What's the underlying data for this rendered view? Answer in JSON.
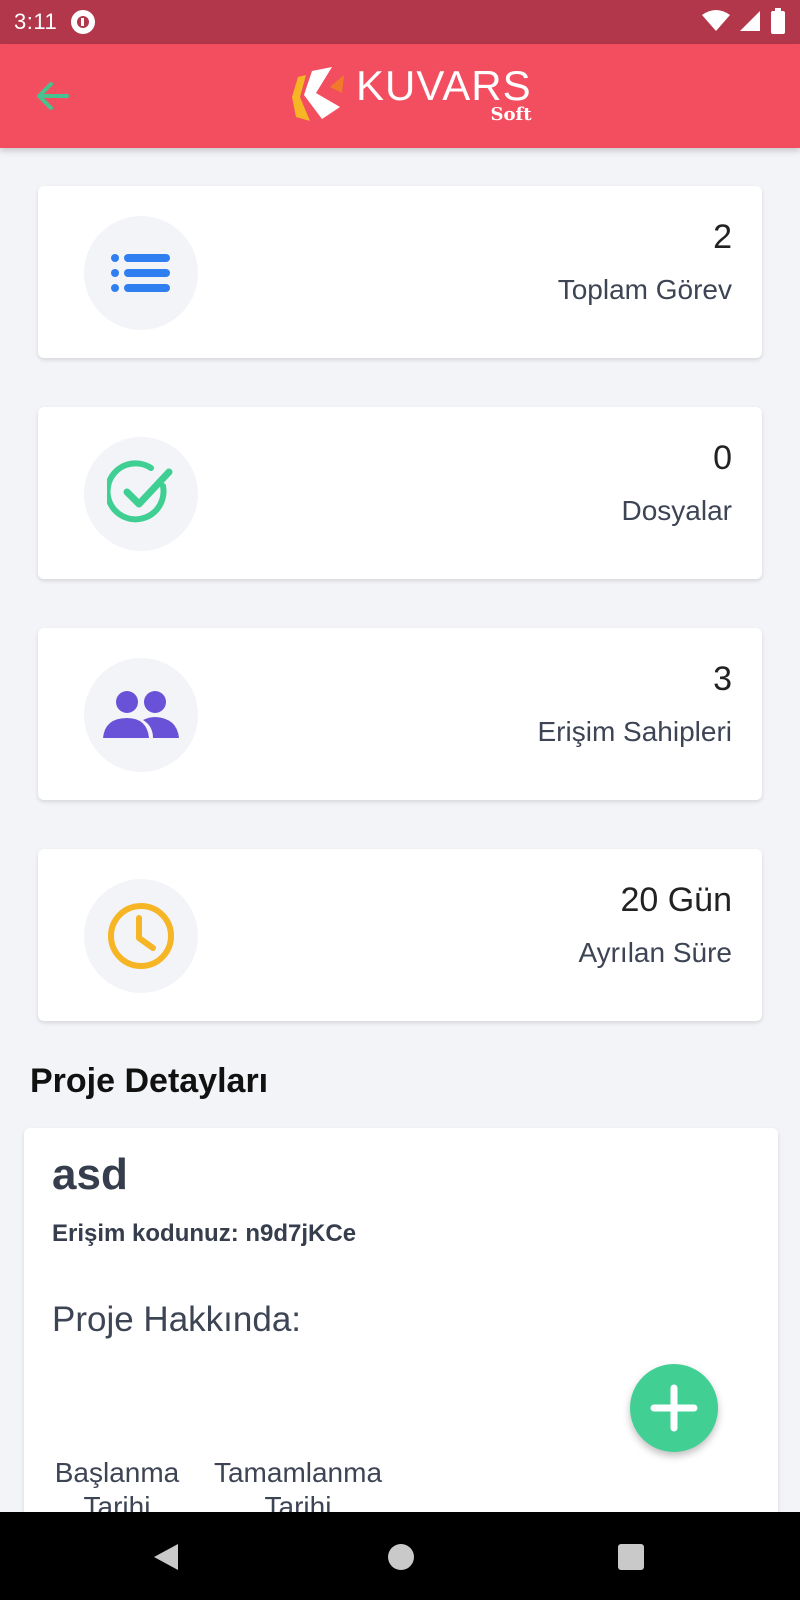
{
  "status_bar": {
    "time": "3:11",
    "icons": [
      "app-notification-icon",
      "wifi-icon",
      "signal-icon",
      "battery-icon"
    ]
  },
  "app_bar": {
    "back_icon": "arrow-left-icon",
    "logo_text": "KUVARS",
    "logo_sub": "Soft",
    "colors": {
      "background": "#f24e60",
      "back_arrow": "#47c28f"
    }
  },
  "stats": [
    {
      "value": "2",
      "label": "Toplam Görev",
      "icon": "list-icon",
      "color": "#2f7ff0"
    },
    {
      "value": "0",
      "label": "Dosyalar",
      "icon": "check-circle-icon",
      "color": "#3fcf93"
    },
    {
      "value": "3",
      "label": "Erişim Sahipleri",
      "icon": "people-icon",
      "color": "#6a52d8"
    },
    {
      "value": "20 Gün",
      "label": "Ayrılan Süre",
      "icon": "clock-icon",
      "color": "#f5b524"
    }
  ],
  "project": {
    "section_title": "Proje Detayları",
    "name": "asd",
    "access_code_line": "Erişim kodunuz: n9d7jKCe",
    "about_label": "Proje Hakkında:",
    "start_date_label": "Başlanma Tarihi",
    "end_date_label": "Tamamlanma Tarihi"
  },
  "fab": {
    "icon": "plus-icon",
    "color": "#42cf94"
  }
}
